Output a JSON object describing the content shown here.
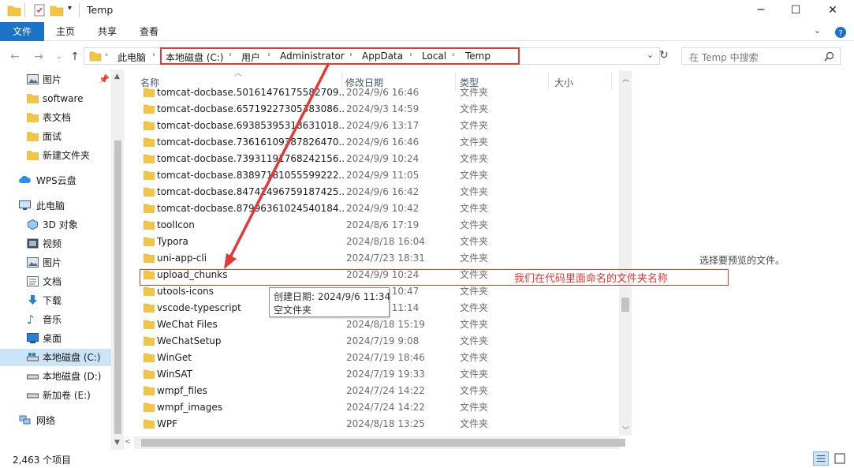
{
  "window": {
    "title": "Temp",
    "controls": {
      "minimize": "─",
      "maximize": "☐",
      "close": "✕"
    }
  },
  "ribbon": {
    "tabs": [
      {
        "label": "文件",
        "active": true
      },
      {
        "label": "主页"
      },
      {
        "label": "共享"
      },
      {
        "label": "查看"
      }
    ]
  },
  "address": {
    "breadcrumbs": [
      "此电脑",
      "本地磁盘 (C:)",
      "用户",
      "Administrator",
      "AppData",
      "Local",
      "Temp"
    ]
  },
  "search": {
    "placeholder": "在 Temp 中搜索"
  },
  "nav_pane": {
    "items": [
      {
        "label": "图片",
        "icon": "pictures-icon",
        "pinned": true
      },
      {
        "label": "software",
        "icon": "folder-icon"
      },
      {
        "label": "表文档",
        "icon": "folder-icon"
      },
      {
        "label": "面试",
        "icon": "folder-icon"
      },
      {
        "label": "新建文件夹",
        "icon": "folder-icon"
      },
      {
        "label": "WPS云盘",
        "icon": "cloud-icon"
      },
      {
        "label": "此电脑",
        "icon": "computer-icon"
      },
      {
        "label": "3D 对象",
        "icon": "3d-objects-icon"
      },
      {
        "label": "视频",
        "icon": "video-icon"
      },
      {
        "label": "图片",
        "icon": "pictures-icon"
      },
      {
        "label": "文档",
        "icon": "documents-icon"
      },
      {
        "label": "下载",
        "icon": "download-icon"
      },
      {
        "label": "音乐",
        "icon": "music-icon"
      },
      {
        "label": "桌面",
        "icon": "desktop-icon"
      },
      {
        "label": "本地磁盘 (C:)",
        "icon": "drive-c-icon",
        "selected": true
      },
      {
        "label": "本地磁盘 (D:)",
        "icon": "drive-icon"
      },
      {
        "label": "新加卷 (E:)",
        "icon": "drive-icon"
      },
      {
        "label": "网络",
        "icon": "network-icon"
      }
    ]
  },
  "file_list": {
    "columns": {
      "name": "名称",
      "date": "修改日期",
      "type": "类型",
      "size": "大小"
    },
    "rows": [
      {
        "name": "tomcat-docbase.50161476175582709...",
        "date": "2024/9/6 16:46",
        "type": "文件夹"
      },
      {
        "name": "tomcat-docbase.65719227305383086...",
        "date": "2024/9/3 14:59",
        "type": "文件夹"
      },
      {
        "name": "tomcat-docbase.69385395318631018...",
        "date": "2024/9/6 13:17",
        "type": "文件夹"
      },
      {
        "name": "tomcat-docbase.73616109387826470...",
        "date": "2024/9/6 16:46",
        "type": "文件夹"
      },
      {
        "name": "tomcat-docbase.73931191768242156...",
        "date": "2024/9/9 10:24",
        "type": "文件夹"
      },
      {
        "name": "tomcat-docbase.83897181055599222...",
        "date": "2024/9/9 11:05",
        "type": "文件夹"
      },
      {
        "name": "tomcat-docbase.84742496759187425...",
        "date": "2024/9/6 16:42",
        "type": "文件夹"
      },
      {
        "name": "tomcat-docbase.87996361024540184...",
        "date": "2024/9/9 10:42",
        "type": "文件夹"
      },
      {
        "name": "toolIcon",
        "date": "2024/8/6 17:19",
        "type": "文件夹"
      },
      {
        "name": "Typora",
        "date": "2024/8/18 16:04",
        "type": "文件夹"
      },
      {
        "name": "uni-app-cli",
        "date": "2024/7/23 18:31",
        "type": "文件夹"
      },
      {
        "name": "upload_chunks",
        "date": "2024/9/9 10:24",
        "type": "文件夹"
      },
      {
        "name": "utools-icons",
        "date": "2024/9/6 10:47",
        "type": "文件夹"
      },
      {
        "name": "vscode-typescript",
        "date": "2024/9/9 11:14",
        "type": "文件夹"
      },
      {
        "name": "WeChat Files",
        "date": "2024/8/18 15:19",
        "type": "文件夹"
      },
      {
        "name": "WeChatSetup",
        "date": "2024/7/19 9:08",
        "type": "文件夹"
      },
      {
        "name": "WinGet",
        "date": "2024/7/19 18:46",
        "type": "文件夹"
      },
      {
        "name": "WinSAT",
        "date": "2024/7/19 19:33",
        "type": "文件夹"
      },
      {
        "name": "wmpf_files",
        "date": "2024/7/24 14:22",
        "type": "文件夹"
      },
      {
        "name": "wmpf_images",
        "date": "2024/7/24 14:22",
        "type": "文件夹"
      },
      {
        "name": "WPF",
        "date": "2024/8/18 13:25",
        "type": "文件夹"
      }
    ]
  },
  "tooltip": {
    "line1": "创建日期: 2024/9/6 11:34",
    "line2": "空文件夹"
  },
  "preview": {
    "text": "选择要预览的文件。"
  },
  "annotation": {
    "text": "我们在代码里面命名的文件夹名称",
    "color": "#e53935"
  },
  "status": {
    "count": "2,463 个项目"
  },
  "colors": {
    "accent": "#1a73c8",
    "folder": "#f4c542",
    "selected_nav": "#cce4f7"
  }
}
